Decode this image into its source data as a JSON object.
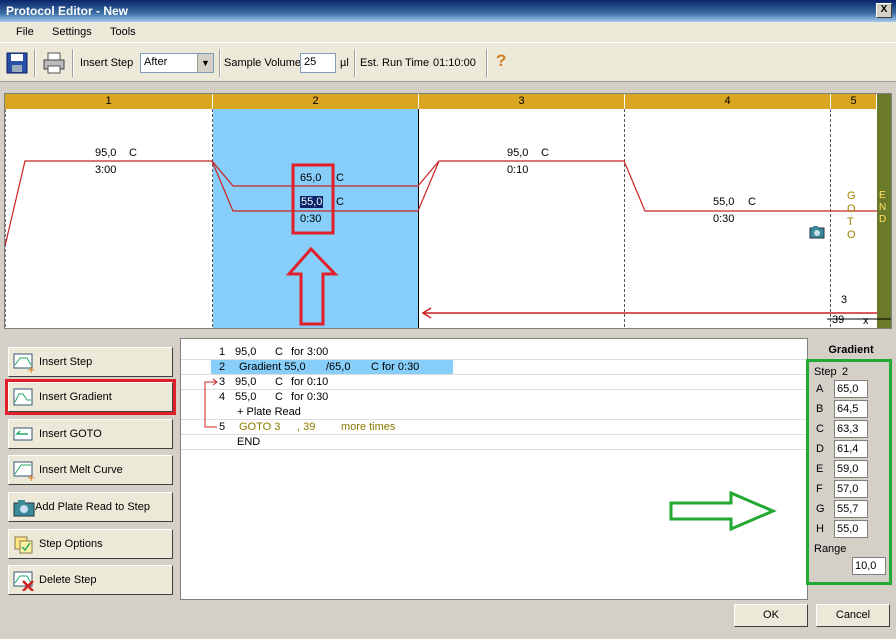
{
  "window": {
    "title": "Protocol Editor - New",
    "close_label": "X"
  },
  "menu": [
    "File",
    "Settings",
    "Tools"
  ],
  "toolbar": {
    "insert_step_label": "Insert Step",
    "insert_step_value": "After",
    "sample_volume_label": "Sample Volume",
    "sample_volume_value": "25",
    "sample_volume_unit": "µl",
    "run_time_label": "Est. Run Time",
    "run_time_value": "01:10:00",
    "help_glyph": "?"
  },
  "graph": {
    "step_headers": [
      "1",
      "2",
      "3",
      "4",
      "5"
    ],
    "end_label": "E N D",
    "step1": {
      "temp": "95,0",
      "unit": "C",
      "time": "3:00"
    },
    "step2": {
      "temp_high": "65,0",
      "temp_low": "55,0",
      "unit": "C",
      "time": "0:30"
    },
    "step3": {
      "temp": "95,0",
      "unit": "C",
      "time": "0:10"
    },
    "step4": {
      "temp": "55,0",
      "unit": "C",
      "time": "0:30"
    },
    "step5": {
      "goto_label": "G O T O",
      "goto_target": "3",
      "cycles": "39",
      "cycles_unit": "x"
    }
  },
  "side_buttons": [
    "Insert Step",
    "Insert Gradient",
    "Insert GOTO",
    "Insert Melt Curve",
    "Add Plate Read to Step",
    "Step Options",
    "Delete Step"
  ],
  "protocol_list": [
    {
      "num": "1",
      "text": "95,0",
      "unit": "C",
      "rest": "for 3:00"
    },
    {
      "num": "2",
      "text": "Gradient  55,0",
      "unit": "/65,0",
      "rest": "C   for 0:30"
    },
    {
      "num": "3",
      "text": "95,0",
      "unit": "C",
      "rest": "for 0:10"
    },
    {
      "num": "4",
      "text": "55,0",
      "unit": "C",
      "rest": "for 0:30"
    },
    {
      "num": "",
      "text": "+ Plate Read",
      "unit": "",
      "rest": ""
    },
    {
      "num": "5",
      "text": "GOTO  3",
      "unit": ", 39",
      "rest": "more times"
    },
    {
      "num": "",
      "text": "END",
      "unit": "",
      "rest": ""
    }
  ],
  "gradient": {
    "title": "Gradient",
    "step_label": "Step",
    "step_value": "2",
    "rows": [
      {
        "letter": "A",
        "value": "65,0"
      },
      {
        "letter": "B",
        "value": "64,5"
      },
      {
        "letter": "C",
        "value": "63,3"
      },
      {
        "letter": "D",
        "value": "61,4"
      },
      {
        "letter": "E",
        "value": "59,0"
      },
      {
        "letter": "F",
        "value": "57,0"
      },
      {
        "letter": "G",
        "value": "55,7"
      },
      {
        "letter": "H",
        "value": "55,0"
      }
    ],
    "range_label": "Range",
    "range_value": "10,0"
  },
  "dialog": {
    "ok": "OK",
    "cancel": "Cancel"
  },
  "colors": {
    "highlight_red": "#e0202a",
    "highlight_green": "#22aa33",
    "step_header": "#daa520",
    "selected_step": "#87cefa",
    "trace": "#cc2222"
  }
}
